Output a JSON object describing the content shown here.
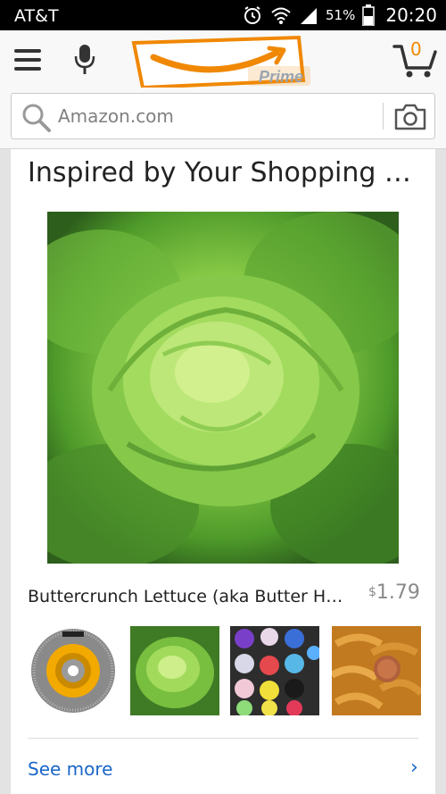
{
  "status_bar": {
    "carrier": "AT&T",
    "battery_percent": "51%",
    "time": "20:20"
  },
  "header": {
    "logo_text": "Prime",
    "cart_count": "0",
    "search": {
      "placeholder": "Amazon.com"
    }
  },
  "colors": {
    "brand_orange": "#f08804",
    "link_blue": "#1b66c9"
  },
  "card": {
    "title": "Inspired by Your Shopping T...",
    "product": {
      "name": "Buttercrunch Lettuce (aka Butter Hea...",
      "price_currency": "$",
      "price_amount": "1.79"
    },
    "see_more_label": "See more",
    "see_more_chevron": "›"
  }
}
